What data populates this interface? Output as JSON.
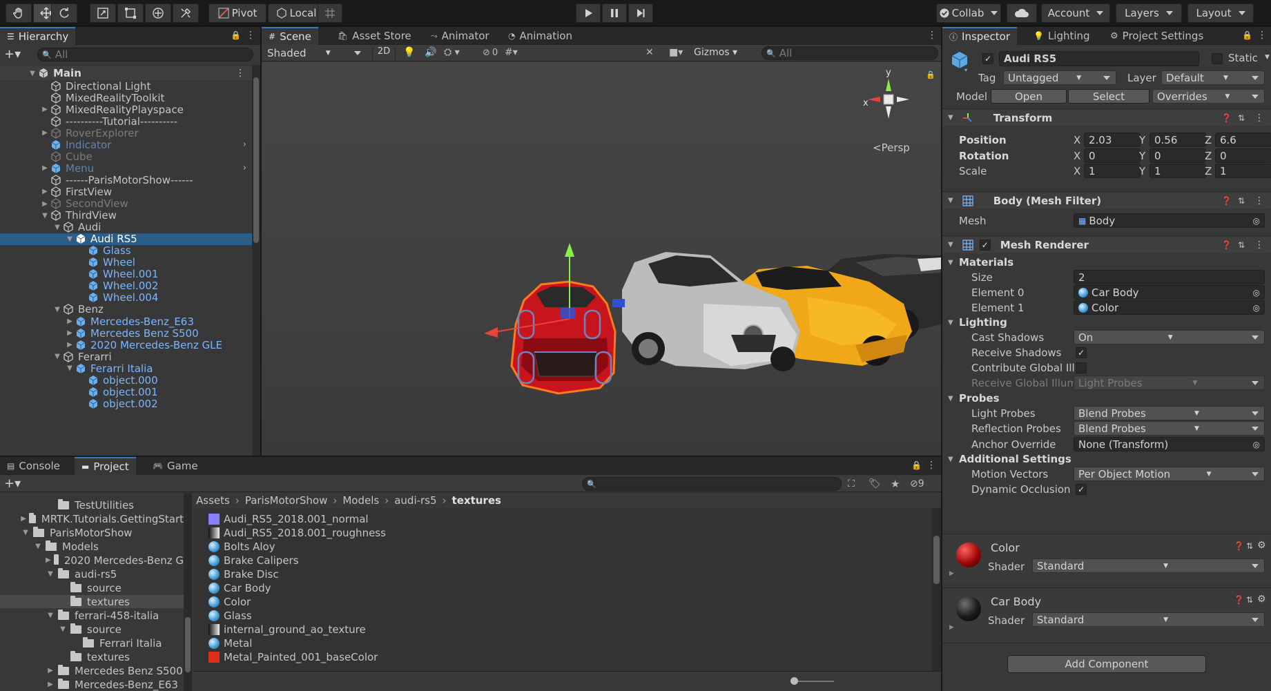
{
  "toolbar": {
    "pivot": "Pivot",
    "local": "Local",
    "collab": "Collab",
    "account": "Account",
    "layers": "Layers",
    "layout": "Layout"
  },
  "hierarchy": {
    "tab": "Hierarchy",
    "search_placeholder": "All",
    "root": "Main",
    "items": [
      {
        "label": "Directional Light"
      },
      {
        "label": "MixedRealityToolkit"
      },
      {
        "label": "MixedRealityPlayspace"
      },
      {
        "label": "----------Tutorial----------"
      },
      {
        "label": "RoverExplorer"
      },
      {
        "label": "Indicator"
      },
      {
        "label": "Cube"
      },
      {
        "label": "Menu"
      },
      {
        "label": "------ParisMotorShow------"
      },
      {
        "label": "FirstView"
      },
      {
        "label": "SecondView"
      },
      {
        "label": "ThirdView"
      },
      {
        "label": "Audi"
      },
      {
        "label": "Audi RS5"
      },
      {
        "label": "Glass"
      },
      {
        "label": "Wheel"
      },
      {
        "label": "Wheel.001"
      },
      {
        "label": "Wheel.002"
      },
      {
        "label": "Wheel.004"
      },
      {
        "label": "Benz"
      },
      {
        "label": "Mercedes-Benz_E63"
      },
      {
        "label": "Mercedes Benz S500"
      },
      {
        "label": "2020 Mercedes-Benz GLE"
      },
      {
        "label": "Ferarri"
      },
      {
        "label": "Ferarri Italia"
      },
      {
        "label": "object.000"
      },
      {
        "label": "object.001"
      },
      {
        "label": "object.002"
      }
    ]
  },
  "scene": {
    "tabs": [
      "Scene",
      "Asset Store",
      "Animator",
      "Animation"
    ],
    "shading": "Shaded",
    "mode_2d": "2D",
    "hidden_count": "0",
    "gizmos": "Gizmos",
    "search_placeholder": "All",
    "persp": "Persp",
    "axis_x": "x",
    "axis_y": "y"
  },
  "inspector": {
    "tabs": [
      "Inspector",
      "Lighting",
      "Project Settings"
    ],
    "object_name": "Audi RS5",
    "static": "Static",
    "tag_label": "Tag",
    "tag": "Untagged",
    "layer_label": "Layer",
    "layer": "Default",
    "model_label": "Model",
    "open": "Open",
    "select": "Select",
    "overrides": "Overrides",
    "transform": {
      "title": "Transform",
      "position_label": "Position",
      "rotation_label": "Rotation",
      "scale_label": "Scale",
      "x": "X",
      "y": "Y",
      "z": "Z",
      "position": [
        "2.03",
        "0.56",
        "6.6"
      ],
      "rotation": [
        "0",
        "0",
        "0"
      ],
      "scale": [
        "1",
        "1",
        "1"
      ]
    },
    "mesh_filter": {
      "title": "Body (Mesh Filter)",
      "mesh_label": "Mesh",
      "mesh": "Body"
    },
    "mesh_renderer": {
      "title": "Mesh Renderer",
      "materials": "Materials",
      "size_label": "Size",
      "size": "2",
      "element0_label": "Element 0",
      "element0": "Car Body",
      "element1_label": "Element 1",
      "element1": "Color",
      "lighting": "Lighting",
      "cast_shadows_label": "Cast Shadows",
      "cast_shadows": "On",
      "receive_shadows_label": "Receive Shadows",
      "contribute_gi_label": "Contribute Global Illu",
      "receive_gi_label": "Receive Global Illum",
      "receive_gi": "Light Probes",
      "probes": "Probes",
      "light_probes_label": "Light Probes",
      "light_probes": "Blend Probes",
      "reflection_probes_label": "Reflection Probes",
      "reflection_probes": "Blend Probes",
      "anchor_override_label": "Anchor Override",
      "anchor_override": "None (Transform)",
      "additional": "Additional Settings",
      "motion_vectors_label": "Motion Vectors",
      "motion_vectors": "Per Object Motion",
      "dynamic_occlusion_label": "Dynamic Occlusion"
    },
    "materials": [
      {
        "name": "Color",
        "shader_label": "Shader",
        "shader": "Standard"
      },
      {
        "name": "Car Body",
        "shader_label": "Shader",
        "shader": "Standard"
      }
    ],
    "add_component": "Add Component"
  },
  "bottom": {
    "tabs": [
      "Console",
      "Project",
      "Game"
    ],
    "hidden_count": "9",
    "breadcrumb": [
      "Assets",
      "ParisMotorShow",
      "Models",
      "audi-rs5",
      "textures"
    ],
    "tree": [
      {
        "label": "TestUtilities"
      },
      {
        "label": "MRTK.Tutorials.GettingStart"
      },
      {
        "label": "ParisMotorShow"
      },
      {
        "label": "Models"
      },
      {
        "label": "2020 Mercedes-Benz G"
      },
      {
        "label": "audi-rs5"
      },
      {
        "label": "source"
      },
      {
        "label": "textures"
      },
      {
        "label": "ferrari-458-italia"
      },
      {
        "label": "source"
      },
      {
        "label": "Ferrari Italia"
      },
      {
        "label": "textures"
      },
      {
        "label": "Mercedes Benz S500"
      },
      {
        "label": "Mercedes-Benz_E63"
      }
    ],
    "assets": [
      {
        "label": "Audi_RS5_2018.001_normal",
        "icon": "normal-map"
      },
      {
        "label": "Audi_RS5_2018.001_roughness",
        "icon": "texture"
      },
      {
        "label": "Bolts Aloy",
        "icon": "material"
      },
      {
        "label": "Brake Calipers",
        "icon": "material"
      },
      {
        "label": "Brake Disc",
        "icon": "material"
      },
      {
        "label": "Car Body",
        "icon": "material"
      },
      {
        "label": "Color",
        "icon": "material"
      },
      {
        "label": "Glass",
        "icon": "material"
      },
      {
        "label": "internal_ground_ao_texture",
        "icon": "texture"
      },
      {
        "label": "Metal",
        "icon": "material"
      },
      {
        "label": "Metal_Painted_001_baseColor",
        "icon": "texture-red"
      }
    ]
  },
  "colors": {
    "selection": "#2c5d87",
    "accent_blue": "#7ab6ff",
    "car_red": "#c8141c",
    "car_yellow": "#f0a818",
    "outline": "#ff7a1a"
  }
}
